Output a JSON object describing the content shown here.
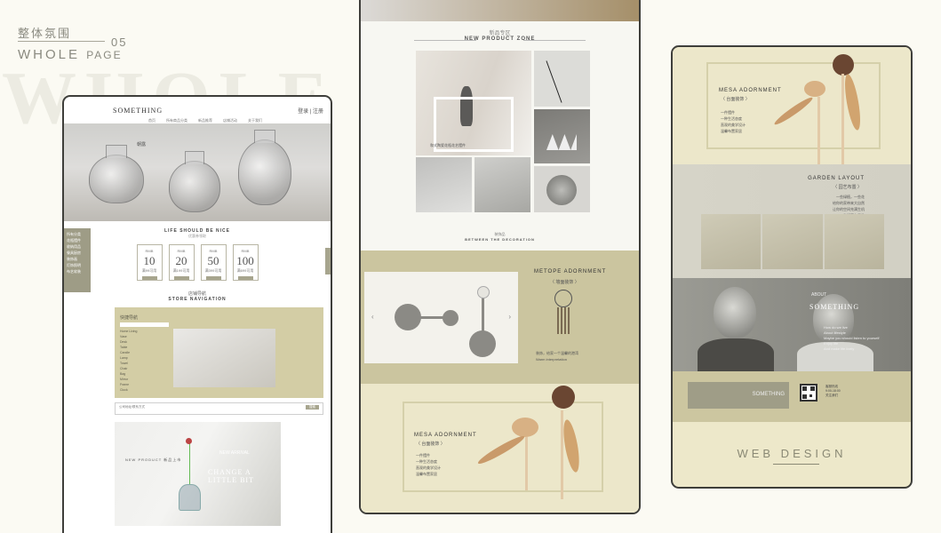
{
  "header": {
    "title_cn": "整体氛围",
    "number": "05",
    "title_en": "WHOLE",
    "title_en_small": "PAGE",
    "bg_word": "WHOLE"
  },
  "page1": {
    "logo": "SOMETHING",
    "login": "登录 | 注册",
    "nav": [
      "首页",
      "所有商品分类",
      "新品推荐",
      "店铺活动",
      "关于我们"
    ],
    "hero_text": "朝露",
    "side_menu": [
      "所有分类",
      "花瓶摆件",
      "收纳用品",
      "餐具厨房",
      "装饰画",
      "灯饰照明",
      "布艺软装"
    ],
    "tagline": "LIFE SHOULD BE NICE",
    "tagline_sub": "优惠券领取",
    "coupons": [
      {
        "label": "RMB",
        "value": "10",
        "note": "满99可用"
      },
      {
        "label": "RMB",
        "value": "20",
        "note": "满199可用"
      },
      {
        "label": "RMB",
        "value": "50",
        "note": "满399可用"
      },
      {
        "label": "RMB",
        "value": "100",
        "note": "满699可用"
      }
    ],
    "store_cn": "店铺导航",
    "store_en": "STORE NAVIGATION",
    "store_title": "快捷导航",
    "store_list": [
      "Home Living",
      "Vase",
      "Desk",
      "Table",
      "Candle",
      "Lamp",
      "Towel",
      "Chair",
      "Bag",
      "Mirror",
      "Frame",
      "Clock"
    ],
    "bar_text": "公司地址/联系方式",
    "bar_btn": "搜索",
    "np_label": "NEW PRODUCT 新品上市",
    "np_slogan": "CHANGE A LITTLE BIT",
    "np_arrival": "NEW ARRIVAL"
  },
  "page2": {
    "zone_cn": "新品专区",
    "zone_en": "NEW PRODUCT ZONE",
    "caption": "和式陶瓷花瓶花艺摆件",
    "between_cn": "装饰品",
    "between_en": "BETWEEN THE DECORATION",
    "metope_title": "METOPE ADORNMENT",
    "metope_cn": "〈 墙面装饰 〉",
    "metope_desc": "装饰，给家一个温馨的港湾",
    "metope_sub": "Warm interpretation",
    "mesa_title": "MESA ADORNMENT",
    "mesa_cn": "〈 台面装饰 〉",
    "mesa_lines": [
      "一件摆件",
      "一种生活态度",
      "直观的美学设计",
      "温馨布置家居"
    ]
  },
  "page3": {
    "mesa_title": "MESA ADORNMENT",
    "mesa_cn": "〈 台面装饰 〉",
    "mesa_lines": [
      "一件摆件",
      "一种生活态度",
      "直观的美学设计",
      "温馨布置家居"
    ],
    "garden_title": "GARDEN LAYOUT",
    "garden_cn": "〈 园艺布置 〉",
    "garden_lines": [
      "一些绿植，一些花",
      "给你的家带来大自然",
      "让你的空间充满生机",
      "生活更有乐趣"
    ],
    "about": "ABOUT",
    "about_brand": "SOMETHING",
    "about_lines": [
      "How do we live",
      "About lifestyle",
      "Maybe you should listen to yourself",
      "Enjoy life",
      "And make life lively"
    ],
    "footer_brand": "SOMETHING",
    "contact": [
      "客服热线",
      "9:00-18:00",
      "关注我们"
    ],
    "web_design": "WEB DESIGN"
  },
  "colors": {
    "khaki": "#cbc59f",
    "cream": "#ece7ca",
    "dark_khaki": "#9e9c86",
    "frame_border": "#3e3e3a"
  }
}
